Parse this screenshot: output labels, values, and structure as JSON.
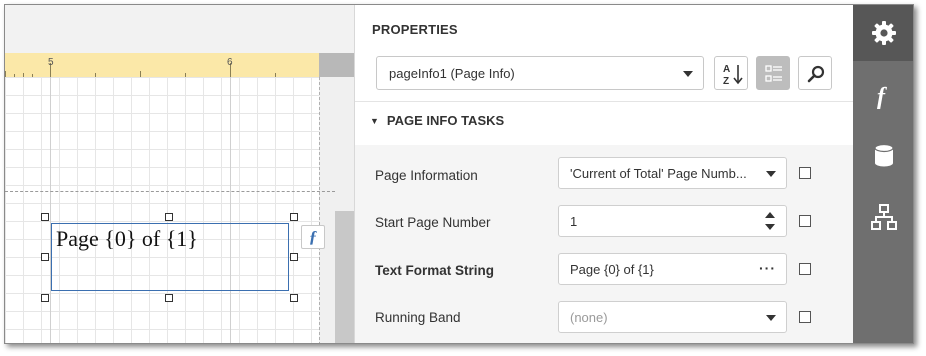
{
  "ruler": {
    "marks": [
      "5",
      "6"
    ]
  },
  "designer": {
    "field_text": "Page {0} of {1}",
    "smart_tag_glyph": "ƒ"
  },
  "properties": {
    "title": "PROPERTIES",
    "selected_component": "pageInfo1 (Page Info)",
    "buttons": {
      "sort_icon": "sort-alphabetical-icon",
      "categories_icon": "categories-icon",
      "search_icon": "search-icon"
    },
    "section_title": "PAGE INFO TASKS",
    "rows": [
      {
        "label": "Page Information",
        "value": "'Current of Total' Page Numb..."
      },
      {
        "label": "Start Page Number",
        "value": "1"
      },
      {
        "label": "Text Format String",
        "value": "Page {0} of {1}"
      },
      {
        "label": "Running Band",
        "value": "(none)"
      }
    ]
  },
  "tabs": [
    "gear-icon",
    "function-icon",
    "database-icon",
    "hierarchy-icon"
  ],
  "colors": {
    "ruler": "#fbe8a8",
    "selection": "#3b6fb0",
    "tabstrip": "#6f6f6f",
    "active_tab": "#575757",
    "active_button": "#bdbdbd"
  }
}
